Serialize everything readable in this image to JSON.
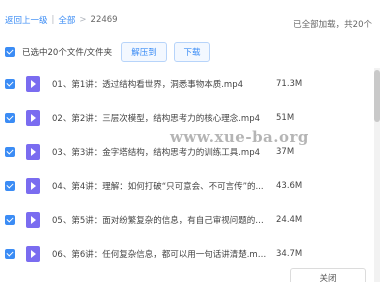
{
  "breadcrumb": {
    "back": "返回上一级",
    "sep1": "|",
    "all": "全部",
    "sep2": ">",
    "current": "22469"
  },
  "status": "已全部加载，共20个",
  "toolbar": {
    "selected_label": "已选中20个文件/文件夹",
    "extract_label": "解压到",
    "download_label": "下载"
  },
  "files": [
    {
      "name": "01、第1讲：透过结构看世界，洞悉事物本质.mp4",
      "size": "71.3M"
    },
    {
      "name": "02、第2讲：三层次模型，结构思考力的核心理念.mp4",
      "size": "51M"
    },
    {
      "name": "03、第3讲：金字塔结构，结构思考力的训练工具.mp4",
      "size": "37M"
    },
    {
      "name": "04、第4讲：理解：如何打破“只可意会、不可言传”的...",
      "size": "43.6M"
    },
    {
      "name": "05、第5讲：面对纷繁复杂的信息，有自己审视问题的坐...",
      "size": "24.4M"
    },
    {
      "name": "06、第6讲：任何复杂信息，都可以用一句话讲清楚.mp4",
      "size": "34.7M"
    }
  ],
  "watermark": "www.xue-ba.org",
  "footer": {
    "close_label": "关闭"
  },
  "colors": {
    "accent": "#3b8cf5",
    "file_icon": "#7a6cf0"
  }
}
